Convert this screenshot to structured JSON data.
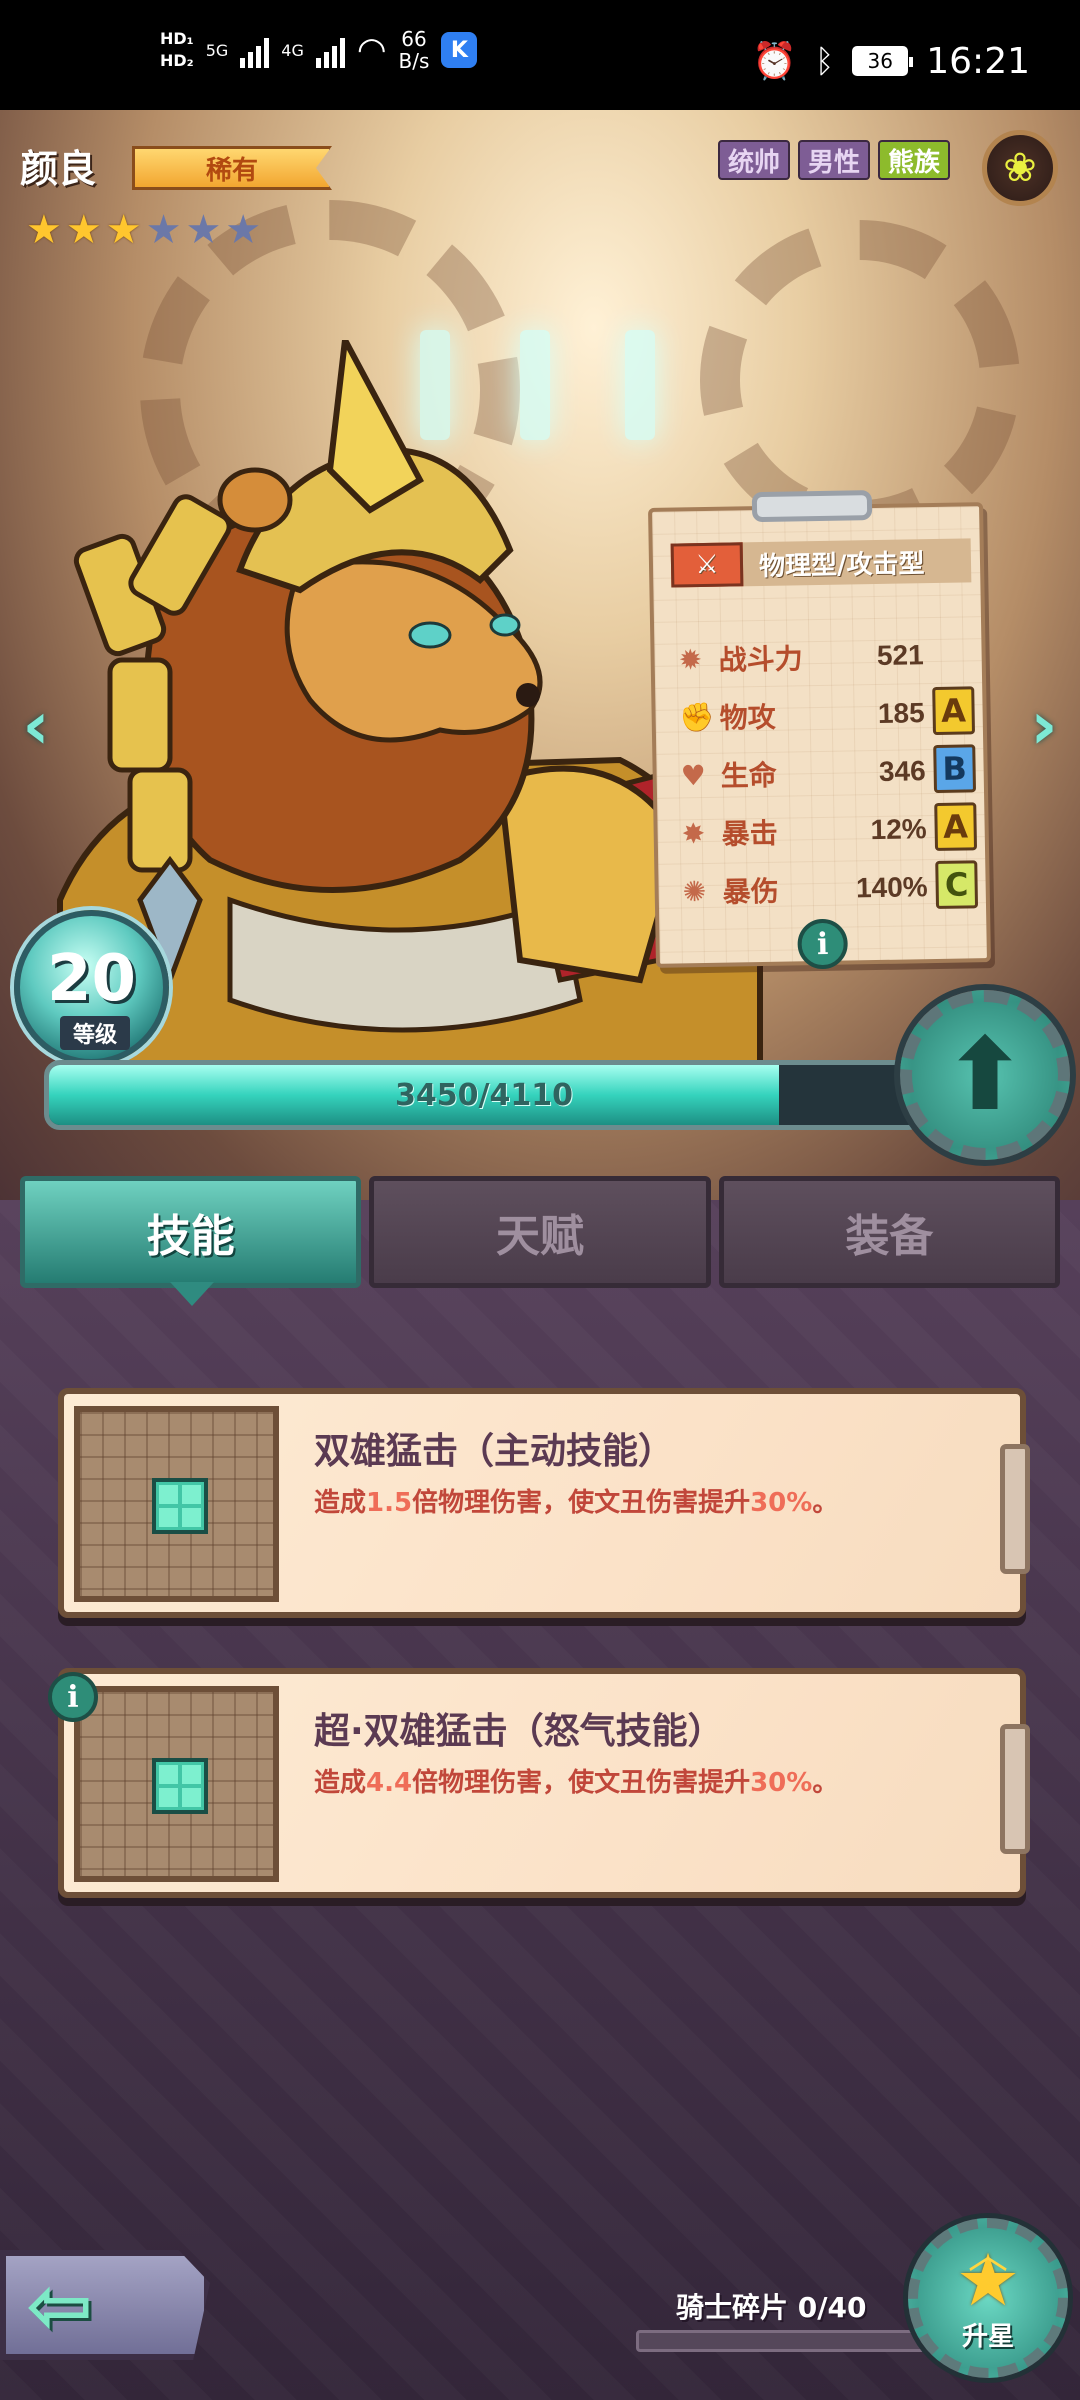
{
  "status_bar": {
    "hd1": "HD₁",
    "hd2": "HD₂",
    "net_5g": "5G",
    "net_4g": "4G",
    "speed_value": "66",
    "speed_unit": "B/s",
    "k_icon": "K",
    "battery": "36",
    "time": "16:21"
  },
  "hero": {
    "name": "颜良",
    "rarity": "稀有",
    "stars": {
      "filled": 3,
      "total": 6
    },
    "tags": [
      "统帅",
      "男性",
      "熊族"
    ],
    "paw_icon": "paw-icon"
  },
  "stats_card": {
    "type_label": "物理型/攻击型",
    "rows": [
      {
        "icon": "power-icon",
        "label": "战斗力",
        "value": "521",
        "grade": ""
      },
      {
        "icon": "attack-icon",
        "label": "物攻",
        "value": "185",
        "grade": "A"
      },
      {
        "icon": "heart-icon",
        "label": "生命",
        "value": "346",
        "grade": "B"
      },
      {
        "icon": "crit-icon",
        "label": "暴击",
        "value": "12%",
        "grade": "A"
      },
      {
        "icon": "crit-damage-icon",
        "label": "暴伤",
        "value": "140%",
        "grade": "C"
      }
    ]
  },
  "level": {
    "value": "20",
    "label": "等级",
    "xp_text": "3450/4110",
    "xp_fraction": 0.839
  },
  "tabs": [
    {
      "label": "技能",
      "active": true
    },
    {
      "label": "天赋",
      "active": false
    },
    {
      "label": "装备",
      "active": false
    }
  ],
  "skills": [
    {
      "name": "双雄猛击（主动技能）",
      "desc_pre": "造成",
      "desc_mult": "1.5",
      "desc_mid": "倍物理伤害，使文丑伤害提升",
      "desc_pct": "30%",
      "desc_post": "。"
    },
    {
      "name": "超·双雄猛击（怒气技能）",
      "desc_pre": "造成",
      "desc_mult": "4.4",
      "desc_mid": "倍物理伤害，使文丑伤害提升",
      "desc_pct": "30%",
      "desc_post": "。"
    }
  ],
  "bottom": {
    "shard_label": "骑士碎片 0/40",
    "shard_fraction": 0,
    "star_up_label": "升星"
  },
  "colors": {
    "accent_teal": "#35d3bd",
    "rarity_gold": "#f2a630",
    "grade_a": "#f3c92e",
    "grade_b": "#5aa6e8",
    "grade_c": "#d6e868"
  }
}
